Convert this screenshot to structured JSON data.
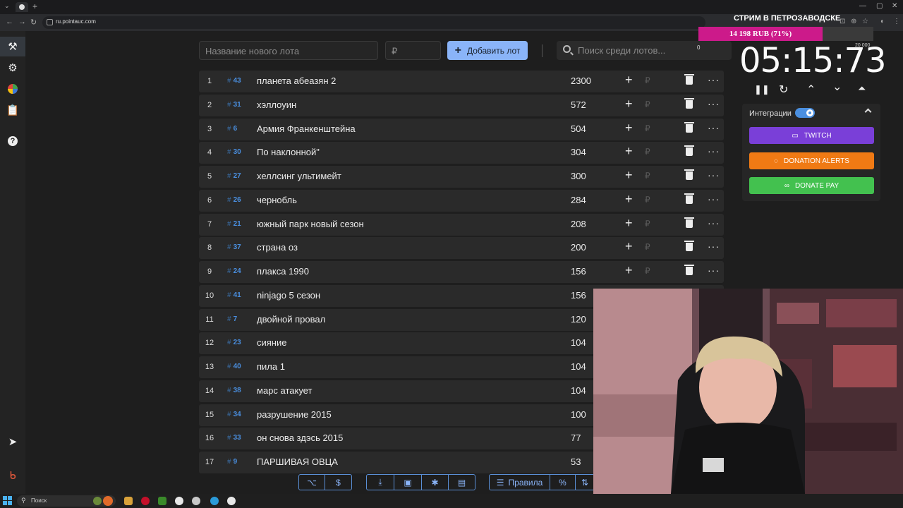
{
  "browser": {
    "url": "ru.pointauc.com",
    "tab_add": "+",
    "tab_menu": "⌄",
    "nav_back": "←",
    "nav_forward": "→",
    "nav_reload": "↻"
  },
  "stream_overlay": {
    "title": "СТРИМ В ПЕТРОЗАВОДСКЕ",
    "progress_text": "14 198 RUB (71%)",
    "progress_percent": 71,
    "goal_label": "20 000"
  },
  "lot_form": {
    "name_placeholder": "Название нового лота",
    "amount_placeholder": "₽",
    "add_button": "Добавить лот",
    "search_placeholder": "Поиск среди лотов...",
    "search_count": "0"
  },
  "timer": {
    "value": "05:15:73",
    "pause": "❚❚",
    "reset": "↻",
    "up": "⌃",
    "down": "⌄",
    "upper": "⏶"
  },
  "integrations": {
    "label": "Интеграции",
    "enabled": true,
    "buttons": [
      {
        "label": "TWITCH",
        "color": "#7a3fd8"
      },
      {
        "label": "DONATION ALERTS",
        "color": "#f07a14"
      },
      {
        "label": "DONATE PAY",
        "color": "#43c14f"
      }
    ]
  },
  "lots": [
    {
      "index": "1",
      "id": "43",
      "name": "планета абеазян 2",
      "amount": "2300"
    },
    {
      "index": "2",
      "id": "31",
      "name": "хэллоуин",
      "amount": "572"
    },
    {
      "index": "3",
      "id": "6",
      "name": "Армия Франкенштейна",
      "amount": "504"
    },
    {
      "index": "4",
      "id": "30",
      "name": "По наклонной\"",
      "amount": "304"
    },
    {
      "index": "5",
      "id": "27",
      "name": "хеллсинг ультимейт",
      "amount": "300"
    },
    {
      "index": "6",
      "id": "26",
      "name": "чернобль",
      "amount": "284"
    },
    {
      "index": "7",
      "id": "21",
      "name": "южный парк новый сезон",
      "amount": "208"
    },
    {
      "index": "8",
      "id": "37",
      "name": "страна оз",
      "amount": "200"
    },
    {
      "index": "9",
      "id": "24",
      "name": "плакса 1990",
      "amount": "156"
    },
    {
      "index": "10",
      "id": "41",
      "name": "ninjago 5 сезон",
      "amount": "156"
    },
    {
      "index": "11",
      "id": "7",
      "name": " двойной провал",
      "amount": "120"
    },
    {
      "index": "12",
      "id": "23",
      "name": "сияние",
      "amount": "104"
    },
    {
      "index": "13",
      "id": "40",
      "name": "пила 1",
      "amount": "104"
    },
    {
      "index": "14",
      "id": "38",
      "name": "марс атакует",
      "amount": "104"
    },
    {
      "index": "15",
      "id": "34",
      "name": "разрушение 2015",
      "amount": "100"
    },
    {
      "index": "16",
      "id": "33",
      "name": "он снова здэсь 2015",
      "amount": "77"
    },
    {
      "index": "17",
      "id": "9",
      "name": "ПАРШИВАЯ ОВЦА",
      "amount": "53"
    }
  ],
  "row_actions": {
    "plus": "+",
    "currency": "₽",
    "more": "···"
  },
  "bottom_toolbar": {
    "github": "⌥",
    "donate": "$",
    "download": "⤓",
    "save": "▣",
    "bug": "✱",
    "clear": "▤",
    "rules": "Правила",
    "percent": "%"
  },
  "taskbar": {
    "search": "Поиск"
  }
}
